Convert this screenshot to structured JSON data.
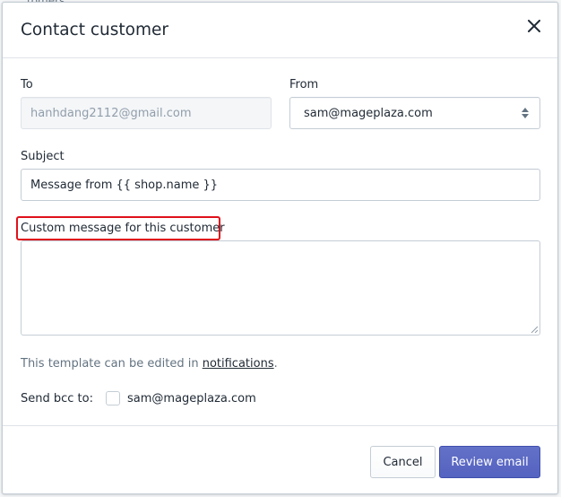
{
  "background": {
    "fragment_top": "tomers"
  },
  "modal": {
    "title": "Contact customer",
    "close_icon": "close-icon"
  },
  "form": {
    "to": {
      "label": "To",
      "value": "hanhdang2112@gmail.com"
    },
    "from": {
      "label": "From",
      "selected": "sam@mageplaza.com"
    },
    "subject": {
      "label": "Subject",
      "value": "Message from {{ shop.name }}"
    },
    "message": {
      "label": "Custom message for this customer",
      "value": ""
    },
    "hint": {
      "prefix": "This template can be edited in ",
      "link": "notifications",
      "suffix": "."
    },
    "bcc": {
      "label": "Send bcc to:",
      "email": "sam@mageplaza.com",
      "checked": false
    }
  },
  "footer": {
    "cancel_label": "Cancel",
    "primary_label": "Review email"
  },
  "colors": {
    "primary": "#5c6ac4",
    "highlight": "#e0111b"
  }
}
